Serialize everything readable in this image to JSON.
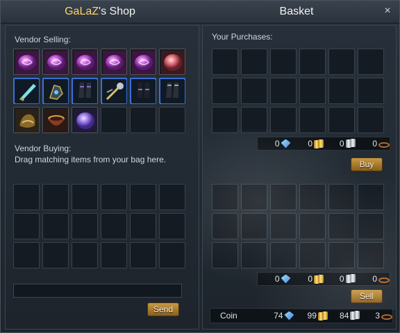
{
  "window": {
    "title_owner": "GaLaZ",
    "title_suffix": "'s Shop",
    "title_right": "Basket",
    "close_glyph": "×"
  },
  "vendor": {
    "selling_label": "Vendor Selling:",
    "buying_label": "Vendor Buying:",
    "buying_hint": "Drag matching items from your bag here.",
    "send_button": "Send",
    "items": [
      {
        "icon": "purple-rune-icon"
      },
      {
        "icon": "purple-rune-icon"
      },
      {
        "icon": "purple-rune-icon"
      },
      {
        "icon": "purple-rune-icon"
      },
      {
        "icon": "purple-rune-icon"
      },
      {
        "icon": "red-crystal-icon"
      },
      {
        "icon": "curved-blade-icon"
      },
      {
        "icon": "armored-glove-icon"
      },
      {
        "icon": "boots-icon"
      },
      {
        "icon": "mace-icon"
      },
      {
        "icon": "boots-icon"
      },
      {
        "icon": "boots-icon"
      },
      {
        "icon": "bronze-helm-icon"
      },
      {
        "icon": "bowl-icon"
      },
      {
        "icon": "violet-crystal-icon"
      }
    ]
  },
  "basket": {
    "purchases_label": "Your Purchases:",
    "buy_button": "Buy",
    "sell_button": "Sell",
    "purchase_totals": {
      "gems": "0",
      "gold": "0",
      "silver": "0",
      "copper": "0"
    },
    "sell_totals": {
      "gems": "0",
      "gold": "0",
      "silver": "0",
      "copper": "0"
    },
    "coin": {
      "label": "Coin",
      "gems": "74",
      "gold": "99",
      "silver": "84",
      "copper": "3"
    }
  },
  "colors": {
    "owner_name": "#ffd36a",
    "button": "#c89a44",
    "slot_highlight": "#3b6fd6"
  }
}
